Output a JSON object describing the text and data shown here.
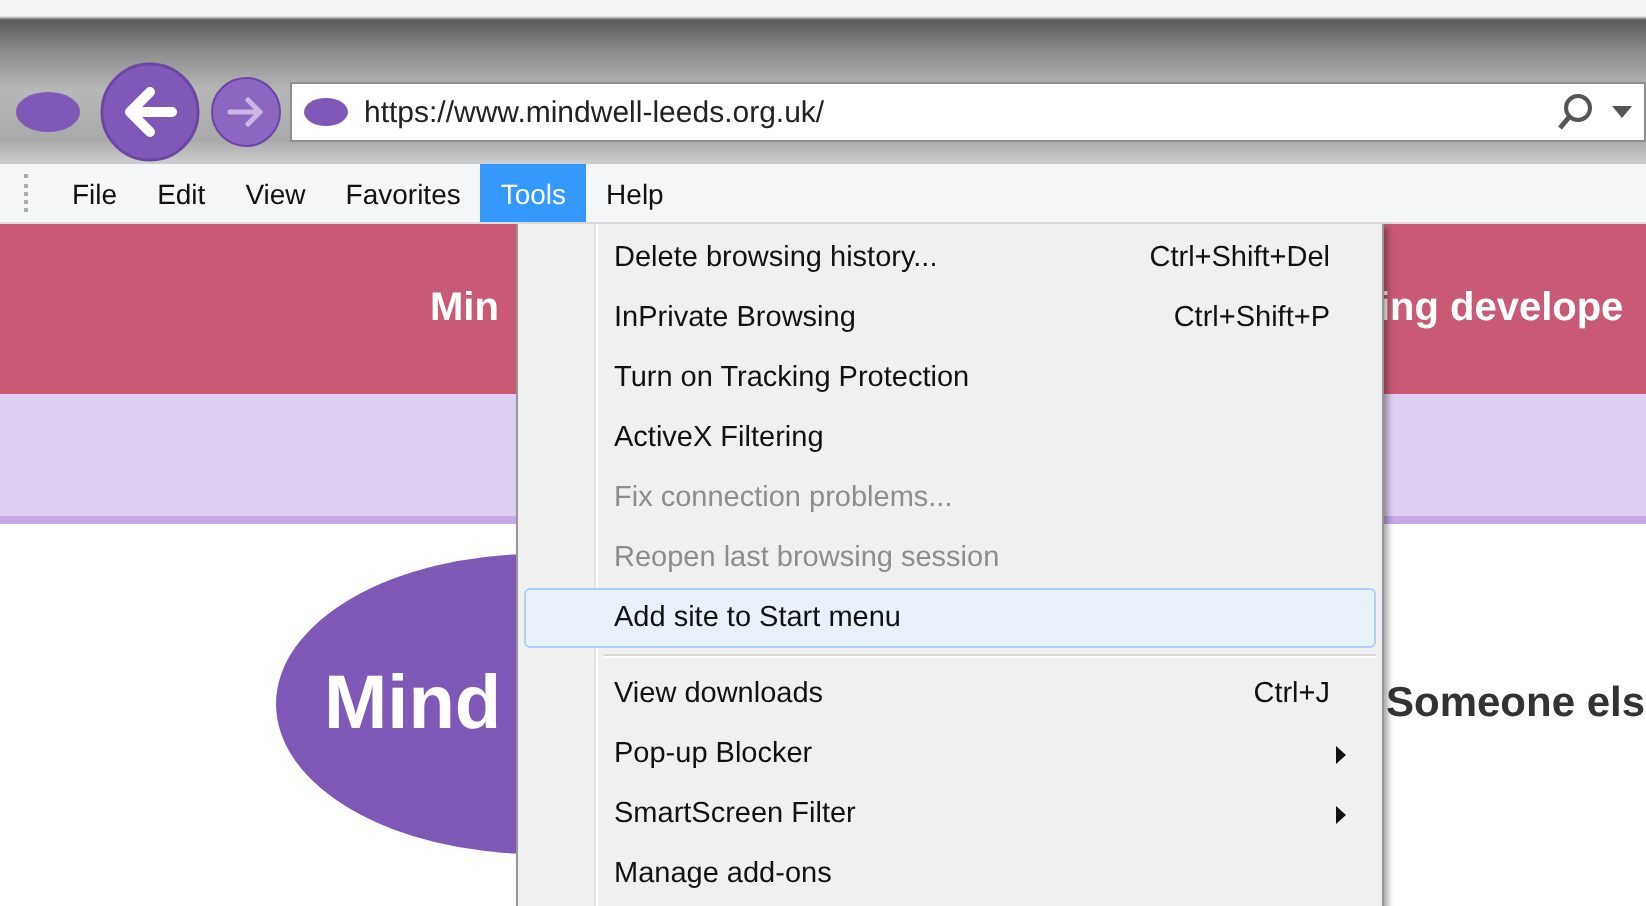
{
  "address_bar": {
    "url": "https://www.mindwell-leeds.org.uk/"
  },
  "menu_bar": [
    {
      "label": "File",
      "selected": false
    },
    {
      "label": "Edit",
      "selected": false
    },
    {
      "label": "View",
      "selected": false
    },
    {
      "label": "Favorites",
      "selected": false
    },
    {
      "label": "Tools",
      "selected": true
    },
    {
      "label": "Help",
      "selected": false
    }
  ],
  "page": {
    "banner_left": "Min",
    "banner_right": "ing develope",
    "logo_text": "Mind",
    "heading": "Someone els"
  },
  "tools_menu": [
    {
      "kind": "item",
      "label": "Delete browsing history...",
      "shortcut": "Ctrl+Shift+Del",
      "disabled": false,
      "highlighted": false,
      "submenu": false
    },
    {
      "kind": "item",
      "label": "InPrivate Browsing",
      "shortcut": "Ctrl+Shift+P",
      "disabled": false,
      "highlighted": false,
      "submenu": false
    },
    {
      "kind": "item",
      "label": "Turn on Tracking Protection",
      "disabled": false,
      "highlighted": false,
      "submenu": false
    },
    {
      "kind": "item",
      "label": "ActiveX Filtering",
      "disabled": false,
      "highlighted": false,
      "submenu": false
    },
    {
      "kind": "item",
      "label": "Fix connection problems...",
      "disabled": true,
      "highlighted": false,
      "submenu": false
    },
    {
      "kind": "item",
      "label": "Reopen last browsing session",
      "disabled": true,
      "highlighted": false,
      "submenu": false
    },
    {
      "kind": "item",
      "label": "Add site to Start menu",
      "disabled": false,
      "highlighted": true,
      "submenu": false
    },
    {
      "kind": "separator"
    },
    {
      "kind": "item",
      "label": "View downloads",
      "shortcut": "Ctrl+J",
      "disabled": false,
      "highlighted": false,
      "submenu": false
    },
    {
      "kind": "item",
      "label": "Pop-up Blocker",
      "disabled": false,
      "highlighted": false,
      "submenu": true
    },
    {
      "kind": "item",
      "label": "SmartScreen Filter",
      "disabled": false,
      "highlighted": false,
      "submenu": true
    },
    {
      "kind": "item",
      "label": "Manage add-ons",
      "disabled": false,
      "highlighted": false,
      "submenu": false
    }
  ]
}
